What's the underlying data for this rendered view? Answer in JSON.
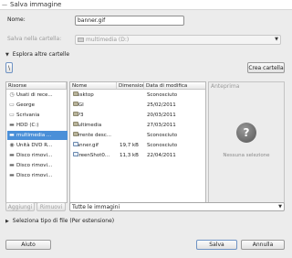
{
  "title": "Salva immagine",
  "title_icon": "window-icon",
  "name_label": "Nome:",
  "name_value": "banner.gif",
  "folder_label": "Salva nella cartella:",
  "folder_value": "multimedia (D:)",
  "browse_label": "Esplora altre cartelle",
  "path_button": "\\",
  "create_folder_button": "Crea cartella",
  "places": {
    "header": "Risorse",
    "items": [
      {
        "label": "Usati di rece...",
        "icon": "clock-icon"
      },
      {
        "label": "George",
        "icon": "folder-icon"
      },
      {
        "label": "Scrivania",
        "icon": "folder-icon"
      },
      {
        "label": "HDD (C:)",
        "icon": "drive-icon"
      },
      {
        "label": "multimedia ...",
        "icon": "drive-icon",
        "selected": true
      },
      {
        "label": "Unità DVD R...",
        "icon": "dvd-icon"
      },
      {
        "label": "Disco rimovi...",
        "icon": "drive-icon"
      },
      {
        "label": "Disco rimovi...",
        "icon": "drive-icon"
      },
      {
        "label": "Disco rimovi...",
        "icon": "drive-icon"
      }
    ]
  },
  "files": {
    "headers": {
      "name": "Nome",
      "size": "Dimensione",
      "modified": "Data di modifica"
    },
    "rows": [
      {
        "name": "Desktop",
        "size": "",
        "modified": "Sconosciuto",
        "type": "folder"
      },
      {
        "name": "GIGI",
        "size": "",
        "modified": "25/02/2011",
        "type": "folder"
      },
      {
        "name": "MP3",
        "size": "",
        "modified": "20/03/2011",
        "type": "folder"
      },
      {
        "name": "multimedia",
        "size": "",
        "modified": "27/03/2011",
        "type": "folder"
      },
      {
        "name": "torrente desc...",
        "size": "",
        "modified": "Sconosciuto",
        "type": "folder"
      },
      {
        "name": "Banner.gif",
        "size": "19,7 kB",
        "modified": "Sconosciuto",
        "type": "image"
      },
      {
        "name": "ScreenShot0...",
        "size": "11,3 kB",
        "modified": "22/04/2011",
        "type": "image"
      }
    ]
  },
  "preview": {
    "header": "Anteprima",
    "empty_text": "Nessuna selezione"
  },
  "add_button": "Aggiungi",
  "remove_button": "Rimuovi",
  "filter_value": "Tutte le immagini",
  "filetype_label": "Seleziona tipo di file (Per estensione)",
  "help_button": "Aiuto",
  "save_button": "Salva",
  "cancel_button": "Annulla"
}
